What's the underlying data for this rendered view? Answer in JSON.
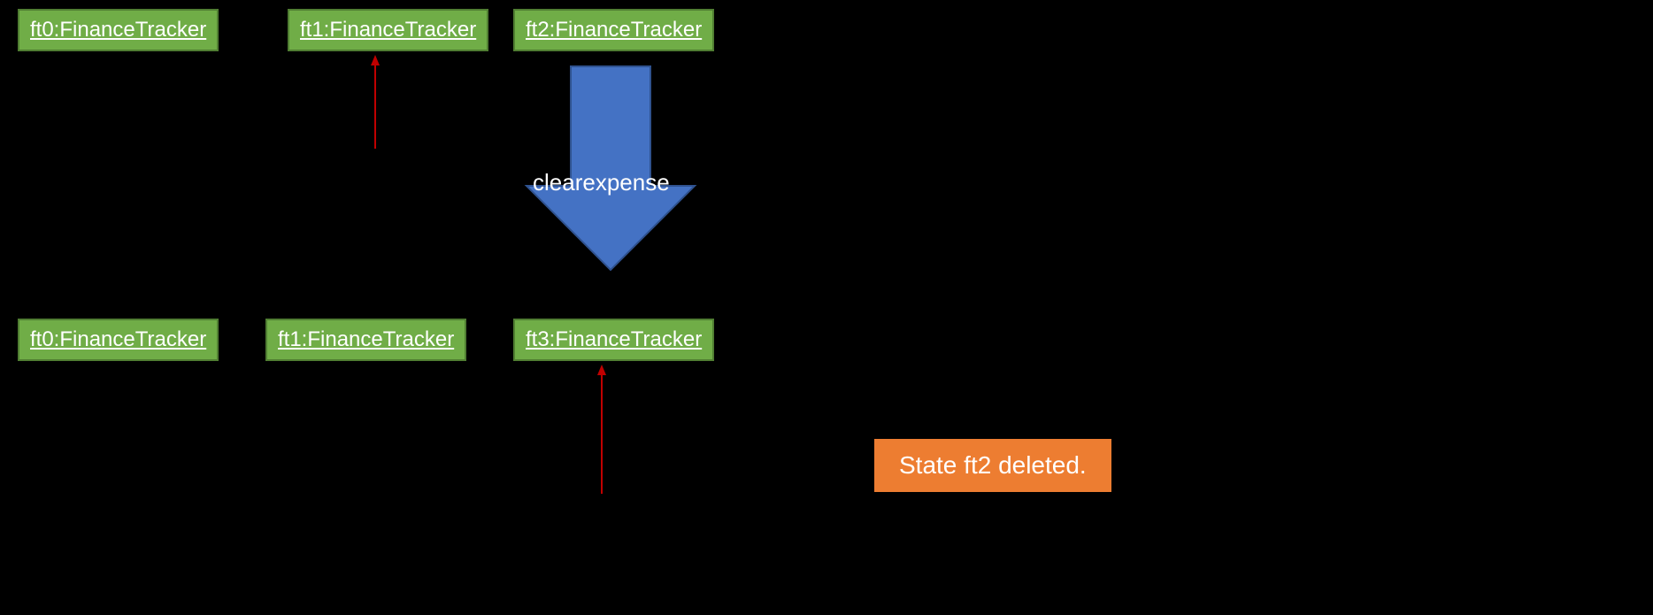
{
  "nodes": {
    "topRow": [
      {
        "label": "ft0:FinanceTracker"
      },
      {
        "label": "ft1:FinanceTracker"
      },
      {
        "label": "ft2:FinanceTracker"
      }
    ],
    "bottomRow": [
      {
        "label": "ft0:FinanceTracker"
      },
      {
        "label": "ft1:FinanceTracker"
      },
      {
        "label": "ft3:FinanceTracker"
      }
    ]
  },
  "transition": {
    "label": "clearexpense"
  },
  "status": {
    "message": "State ft2 deleted."
  },
  "colors": {
    "nodeFill": "#70AD47",
    "nodeBorder": "#507E32",
    "bigArrow": "#4472C4",
    "bigArrowBorder": "#2F528F",
    "redArrow": "#C00000",
    "statusFill": "#ED7D31"
  }
}
